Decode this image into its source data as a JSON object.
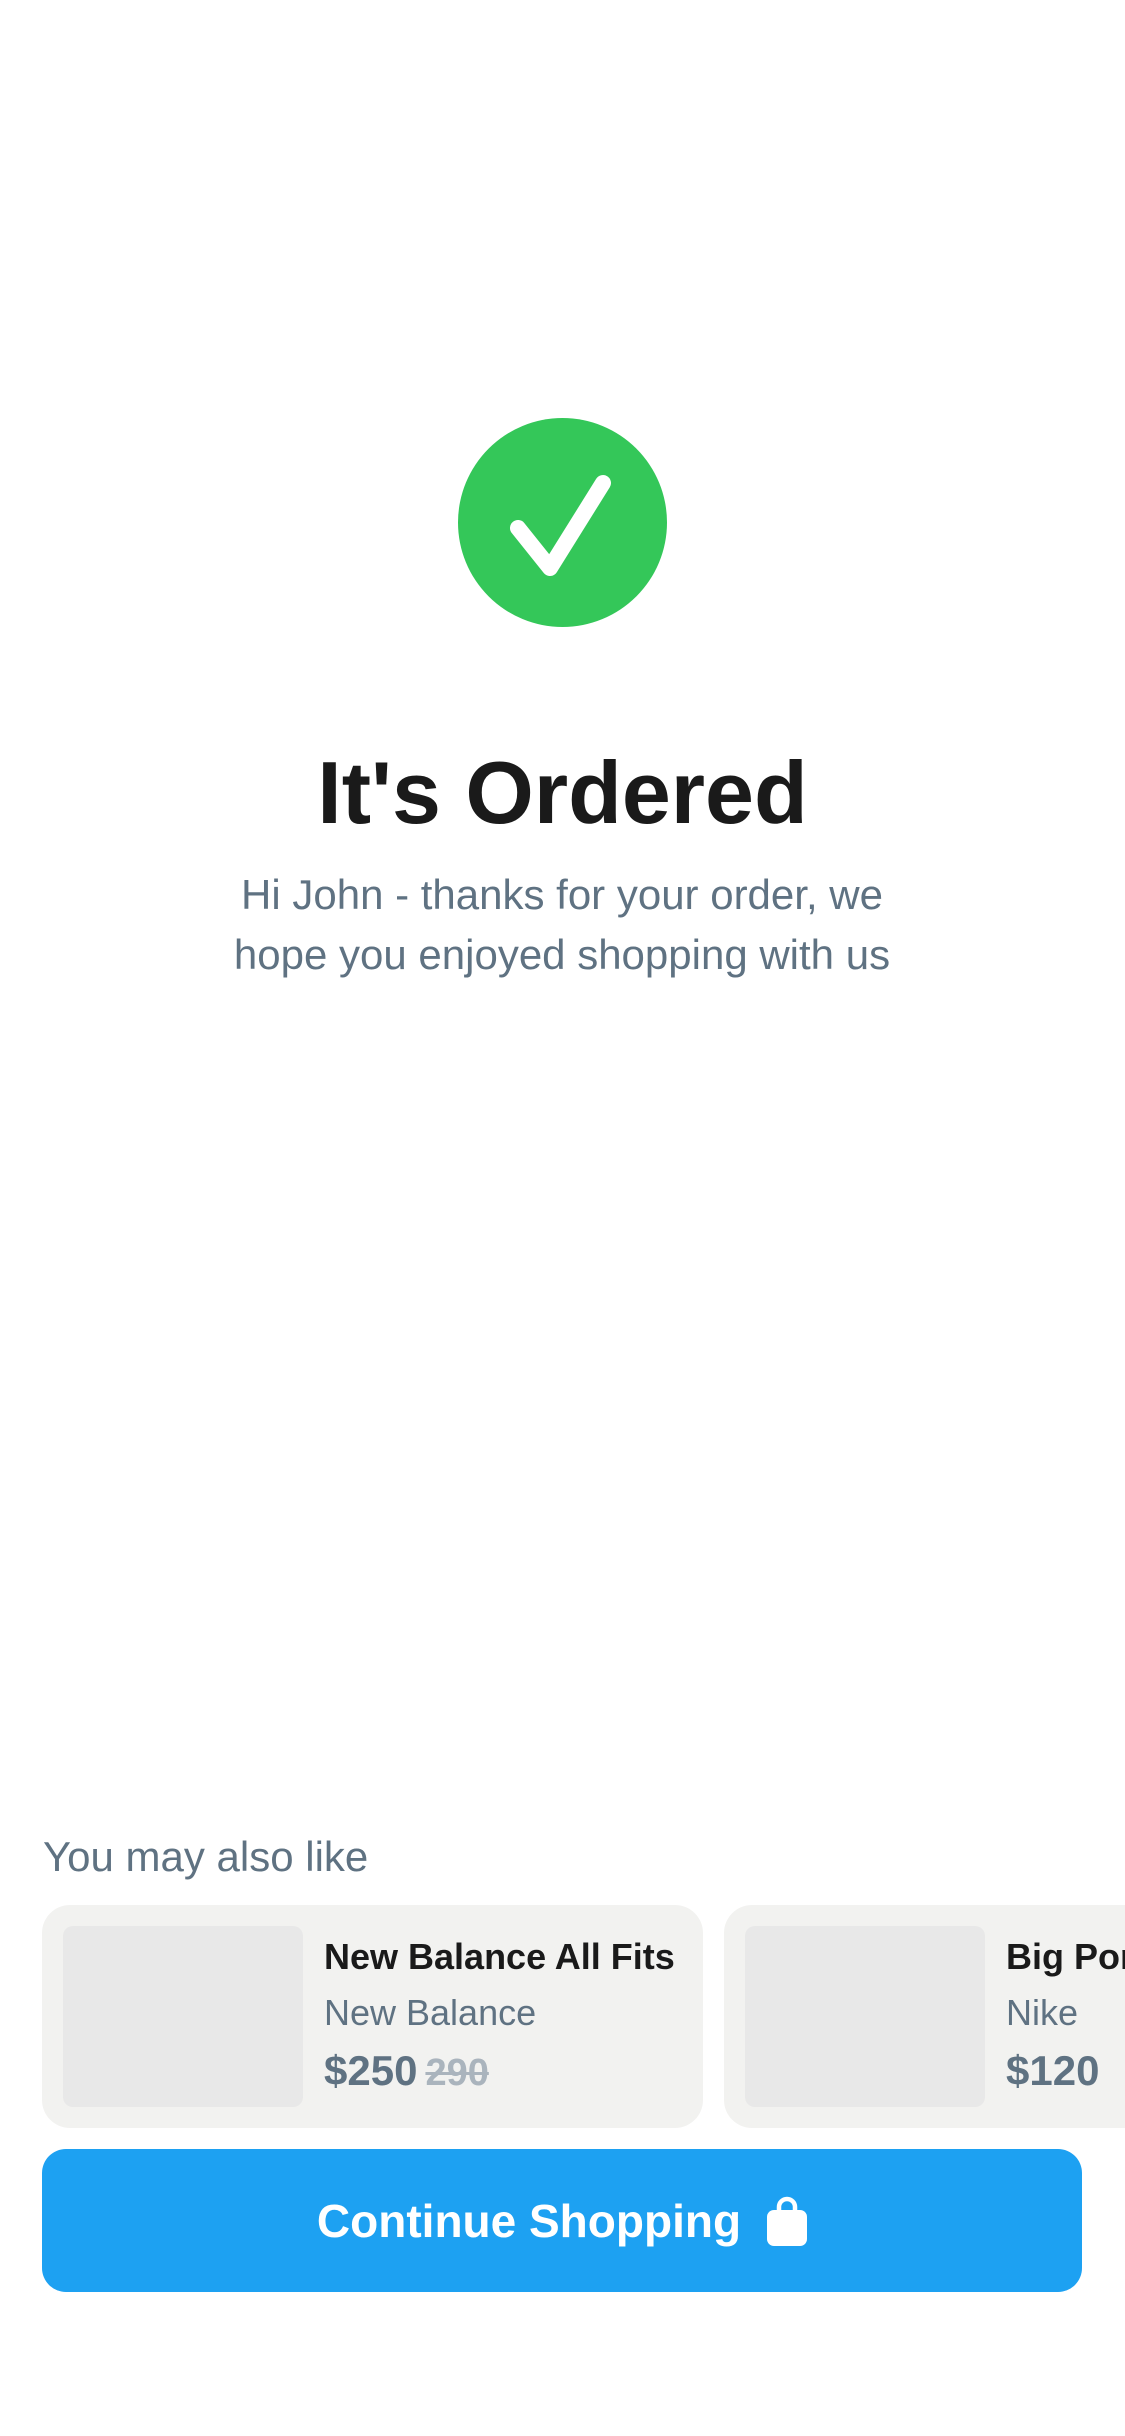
{
  "confirmation": {
    "icon": "checkmark-icon",
    "icon_color": "#34c759",
    "title": "It's Ordered",
    "subtitle": "Hi John - thanks for your order, we hope you enjoyed shopping with us"
  },
  "recommendations": {
    "heading": "You may also like",
    "items": [
      {
        "name": "New Balance All Fits",
        "brand": "New Balance",
        "price": "$250",
        "original_price": "290"
      },
      {
        "name": "Big Pon",
        "brand": "Nike",
        "price": "$120"
      }
    ]
  },
  "cta": {
    "label": "Continue Shopping",
    "icon": "shopping-bag-icon",
    "color": "#1da1f2"
  }
}
